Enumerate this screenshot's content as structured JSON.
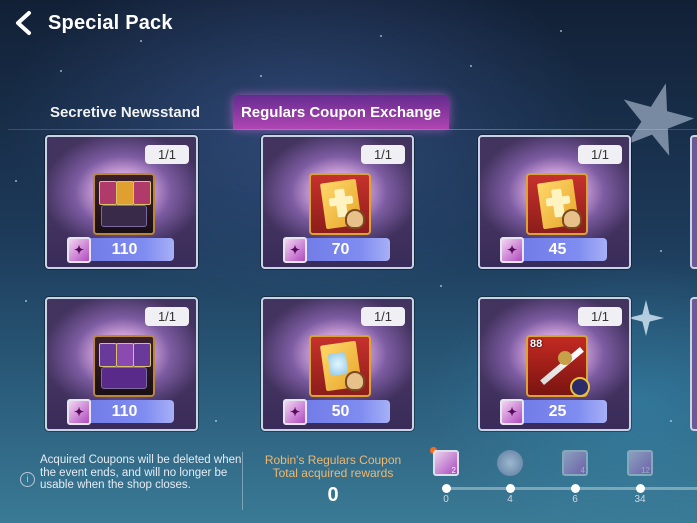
{
  "header": {
    "title": "Special Pack"
  },
  "tabs": [
    {
      "label": "Secretive Newsstand",
      "active": false
    },
    {
      "label": "Regulars Coupon Exchange",
      "active": true
    }
  ],
  "items": [
    {
      "stock": "1/1",
      "price": "110",
      "art": "card-pack-icon"
    },
    {
      "stock": "1/1",
      "price": "70",
      "art": "golden-book-icon"
    },
    {
      "stock": "1/1",
      "price": "45",
      "art": "golden-book-icon"
    },
    {
      "stock": "1/1",
      "price": "110",
      "art": "card-pack-icon"
    },
    {
      "stock": "1/1",
      "price": "50",
      "art": "crystal-book-icon"
    },
    {
      "stock": "1/1",
      "price": "25",
      "art": "weapon-icon",
      "level": "88"
    }
  ],
  "notice": "Acquired Coupons will be deleted when the event ends, and will no longer be usable when the shop closes.",
  "rewards": {
    "title": "Robin's Regulars Coupon Total acquired rewards",
    "total": "0",
    "milestones": [
      {
        "label": "0",
        "icon_count": "2"
      },
      {
        "label": "4",
        "icon_count": ""
      },
      {
        "label": "6",
        "icon_count": "4"
      },
      {
        "label": "34",
        "icon_count": "12"
      }
    ]
  },
  "colors": {
    "tab_active": "#c846be",
    "price_bar": "#7f8cf0",
    "reward_title": "#f0b870"
  }
}
